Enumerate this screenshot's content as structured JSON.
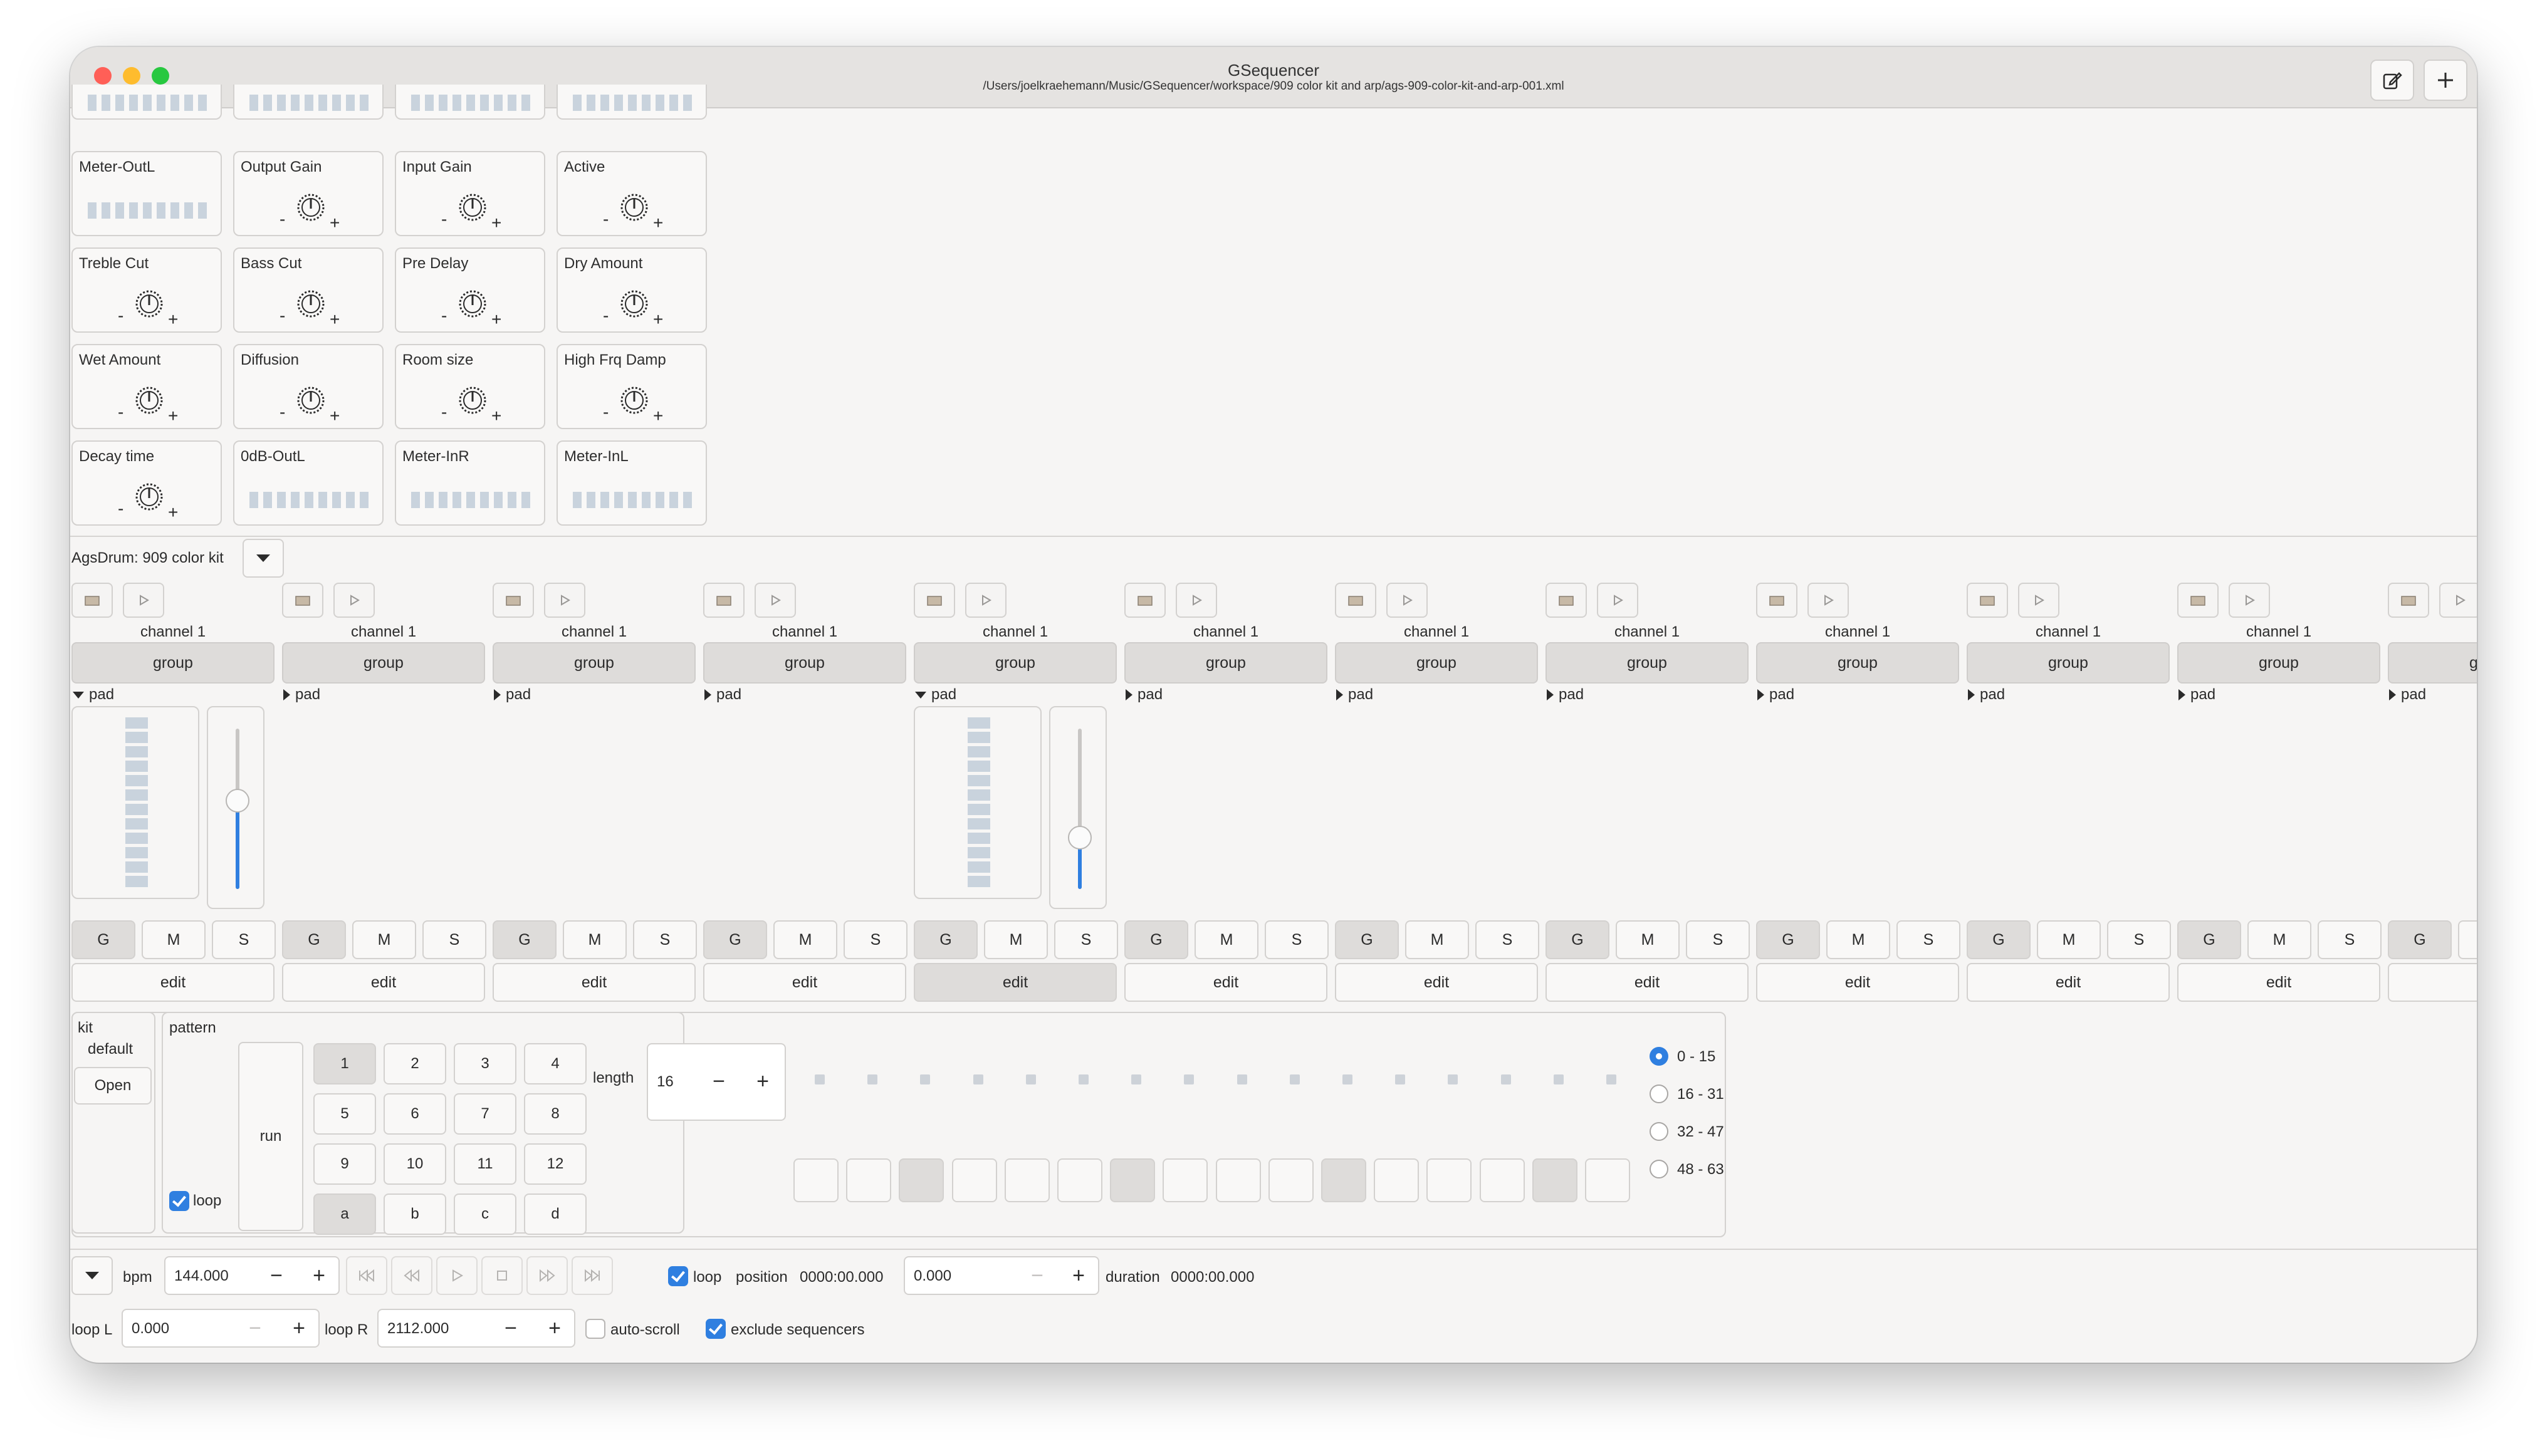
{
  "window": {
    "title": "GSequencer",
    "path": "/Users/joelkraehemann/Music/GSequencer/workspace/909 color kit and arp/ags-909-color-kit-and-arp-001.xml"
  },
  "plugin_controls": [
    {
      "label": "Meter-OutL",
      "type": "meter"
    },
    {
      "label": "Output Gain",
      "type": "knob"
    },
    {
      "label": "Input Gain",
      "type": "knob"
    },
    {
      "label": "Active",
      "type": "knob"
    },
    {
      "label": "Treble Cut",
      "type": "knob"
    },
    {
      "label": "Bass Cut",
      "type": "knob"
    },
    {
      "label": "Pre Delay",
      "type": "knob"
    },
    {
      "label": "Dry Amount",
      "type": "knob"
    },
    {
      "label": "Wet Amount",
      "type": "knob"
    },
    {
      "label": "Diffusion",
      "type": "knob"
    },
    {
      "label": "Room size",
      "type": "knob"
    },
    {
      "label": "High Frq Damp",
      "type": "knob"
    },
    {
      "label": "Decay time",
      "type": "knob"
    },
    {
      "label": "0dB-OutL",
      "type": "meter"
    },
    {
      "label": "Meter-InR",
      "type": "meter"
    },
    {
      "label": "Meter-InL",
      "type": "meter"
    }
  ],
  "knob_signs": {
    "minus": "-",
    "plus": "+"
  },
  "drum": {
    "label": "AgsDrum: 909 color kit"
  },
  "channels": {
    "channel_label": "channel 1",
    "cut_off_label": "cha",
    "group_label": "group",
    "pad_label": "pad",
    "g": "G",
    "m": "M",
    "s": "S",
    "edit_label": "edit",
    "expanded": [
      0,
      4
    ],
    "edit_active": [
      4
    ],
    "fader_levels": [
      0.55,
      0.32
    ]
  },
  "kit": {
    "label": "kit",
    "value": "default",
    "open_label": "Open"
  },
  "pattern": {
    "label": "pattern",
    "run_label": "run",
    "loop_label": "loop",
    "loop_checked": true,
    "buttons": [
      "1",
      "2",
      "3",
      "4",
      "5",
      "6",
      "7",
      "8",
      "9",
      "10",
      "11",
      "12",
      "a",
      "b",
      "c",
      "d"
    ],
    "selected": [
      "1",
      "a"
    ],
    "length_label": "length",
    "length_value": "16",
    "steps_active": [
      2,
      6,
      10,
      14
    ],
    "offsets": [
      "0 - 15",
      "16 - 31",
      "32 - 47",
      "48 - 63"
    ],
    "offset_selected": 0
  },
  "transport": {
    "bpm_label": "bpm",
    "bpm_value": "144.000",
    "loop_label": "loop",
    "loop_checked": true,
    "position_label": "position",
    "position_time": "0000:00.000",
    "position_value": "0.000",
    "duration_label": "duration",
    "duration_time": "0000:00.000",
    "loopL_label": "loop L",
    "loopL_value": "0.000",
    "loopR_label": "loop R",
    "loopR_value": "2112.000",
    "autoscroll_label": "auto-scroll",
    "autoscroll_checked": false,
    "exclude_label": "exclude sequencers",
    "exclude_checked": true
  },
  "colors": {
    "accent": "#2f7fe0",
    "button_selected": "#dedcda",
    "window_bg": "#f6f5f4"
  }
}
